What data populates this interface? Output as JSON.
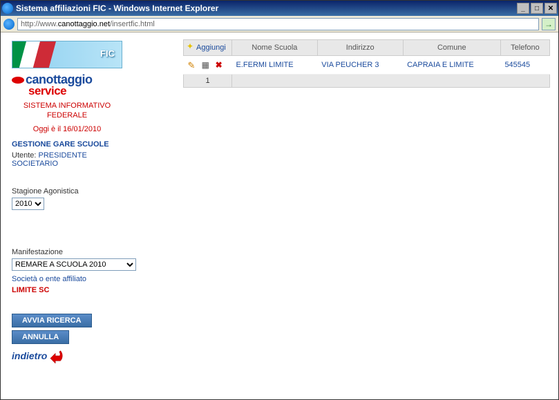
{
  "window": {
    "title": "Sistema affiliazioni FIC - Windows Internet Explorer",
    "url_prefix": "http://www.",
    "url_domain": "canottaggio.net",
    "url_path": "/insertfic.html"
  },
  "sidebar": {
    "logo_fic": "FIC",
    "brand_top": "canottaggio",
    "brand_bottom": "service",
    "system_label_1": "SISTEMA INFORMATIVO",
    "system_label_2": "FEDERALE",
    "date_line": "Oggi è il 16/01/2010",
    "gare_label": "GESTIONE GARE SCUOLE",
    "utente_prefix": "Utente:",
    "utente_role_1": "PRESIDENTE",
    "utente_role_2": "SOCIETARIO",
    "stagione_label": "Stagione Agonistica",
    "stagione_value": "2010",
    "manifestazione_label": "Manifestazione",
    "manifestazione_value": "REMARE A SCUOLA 2010",
    "societa_label": "Società o ente affiliato",
    "societa_value": "LIMITE SC",
    "btn_avvia": "AVVIA RICERCA",
    "btn_annulla": "ANNULLA",
    "btn_indietro": "indietro"
  },
  "table": {
    "headers": {
      "aggiungi": "Aggiungi",
      "nome": "Nome Scuola",
      "indirizzo": "Indirizzo",
      "comune": "Comune",
      "telefono": "Telefono"
    },
    "rows": [
      {
        "nome": "E.FERMI LIMITE",
        "indirizzo": "VIA PEUCHER 3",
        "comune": "CAPRAIA E LIMITE",
        "telefono": "545545"
      }
    ],
    "pager_num": "1"
  }
}
